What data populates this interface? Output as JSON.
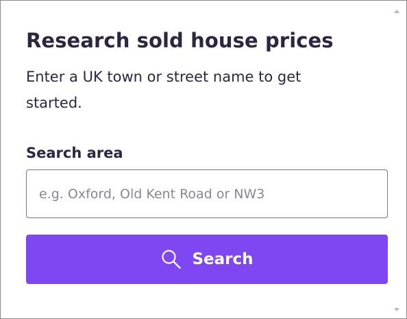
{
  "header": {
    "title": "Research sold house prices",
    "description": "Enter a UK town or street name to get started."
  },
  "search": {
    "label": "Search area",
    "value": "",
    "placeholder": "e.g. Oxford, Old Kent Road or NW3",
    "button_label": "Search",
    "button_icon": "search-icon"
  },
  "colors": {
    "accent": "#7f47f1",
    "text": "#2d2640",
    "placeholder": "#8a8594"
  }
}
